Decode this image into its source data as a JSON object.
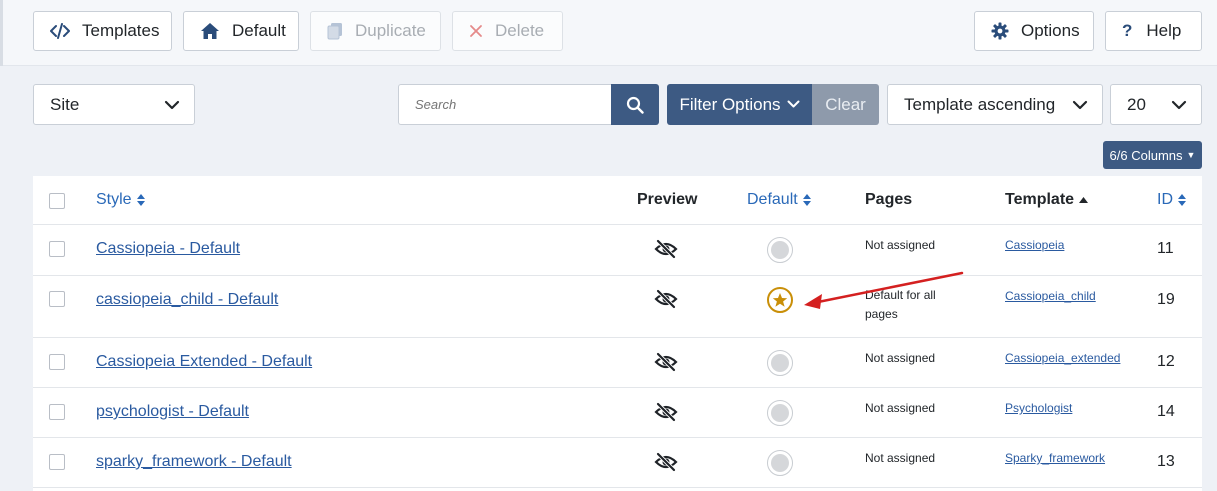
{
  "toolbar": {
    "templates_label": "Templates",
    "default_label": "Default",
    "duplicate_label": "Duplicate",
    "delete_label": "Delete",
    "options_label": "Options",
    "help_label": "Help"
  },
  "filters": {
    "client_value": "Site",
    "search_placeholder": "Search",
    "filter_options_label": "Filter Options",
    "clear_label": "Clear",
    "sort_value": "Template ascending",
    "limit_value": "20",
    "columns_label": "6/6 Columns"
  },
  "table": {
    "headers": {
      "style": "Style",
      "preview": "Preview",
      "default": "Default",
      "pages": "Pages",
      "template": "Template",
      "id": "ID"
    },
    "rows": [
      {
        "style": "Cassiopeia - Default",
        "is_default": false,
        "pages": "Not assigned",
        "template": "Cassiopeia",
        "id": "11"
      },
      {
        "style": "cassiopeia_child - Default",
        "is_default": true,
        "pages": "Default for all pages",
        "template": "Cassiopeia_child",
        "id": "19"
      },
      {
        "style": "Cassiopeia Extended - Default",
        "is_default": false,
        "pages": "Not assigned",
        "template": "Cassiopeia_extended",
        "id": "12"
      },
      {
        "style": "psychologist - Default",
        "is_default": false,
        "pages": "Not assigned",
        "template": "Psychologist",
        "id": "14"
      },
      {
        "style": "sparky_framework - Default",
        "is_default": false,
        "pages": "Not assigned",
        "template": "Sparky_framework",
        "id": "13"
      }
    ]
  },
  "icons": {
    "templates": "code-icon",
    "default": "home-icon",
    "duplicate": "copy-icon",
    "delete": "times-icon",
    "options": "gear-icon",
    "help": "question-icon",
    "preview": "eye-slash-icon",
    "default_star": "star-icon"
  },
  "colors": {
    "primary": "#3d5a83",
    "link": "#2a5aa0",
    "star": "#c98f08",
    "annotation_arrow": "#d42020"
  }
}
